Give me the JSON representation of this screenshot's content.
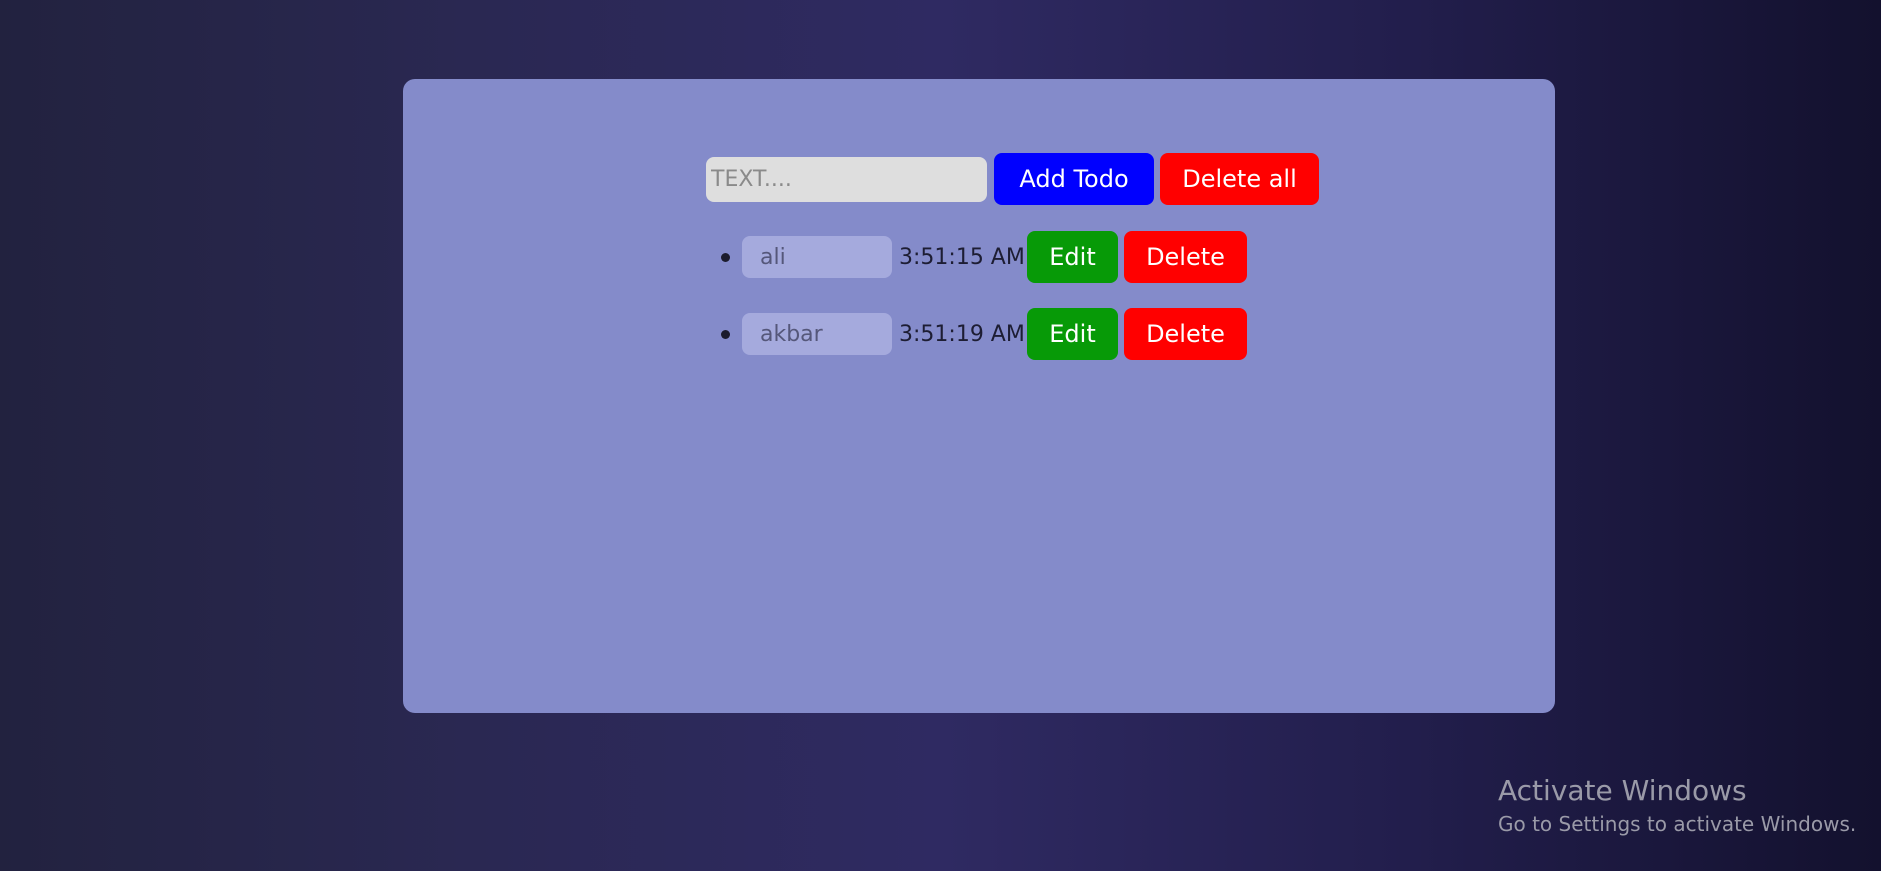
{
  "form": {
    "input_placeholder": "TEXT....",
    "input_value": "",
    "add_label": "Add Todo",
    "delete_all_label": "Delete all"
  },
  "todos": [
    {
      "text": "ali",
      "time": "3:51:15 AM",
      "edit_label": "Edit",
      "delete_label": "Delete"
    },
    {
      "text": "akbar",
      "time": "3:51:19 AM",
      "edit_label": "Edit",
      "delete_label": "Delete"
    }
  ],
  "watermark": {
    "title": "Activate Windows",
    "subtitle": "Go to Settings to activate Windows."
  },
  "colors": {
    "add_button": "#0000ff",
    "delete_button": "#ff0000",
    "edit_button": "#079a07",
    "card_background": "#848bca"
  }
}
